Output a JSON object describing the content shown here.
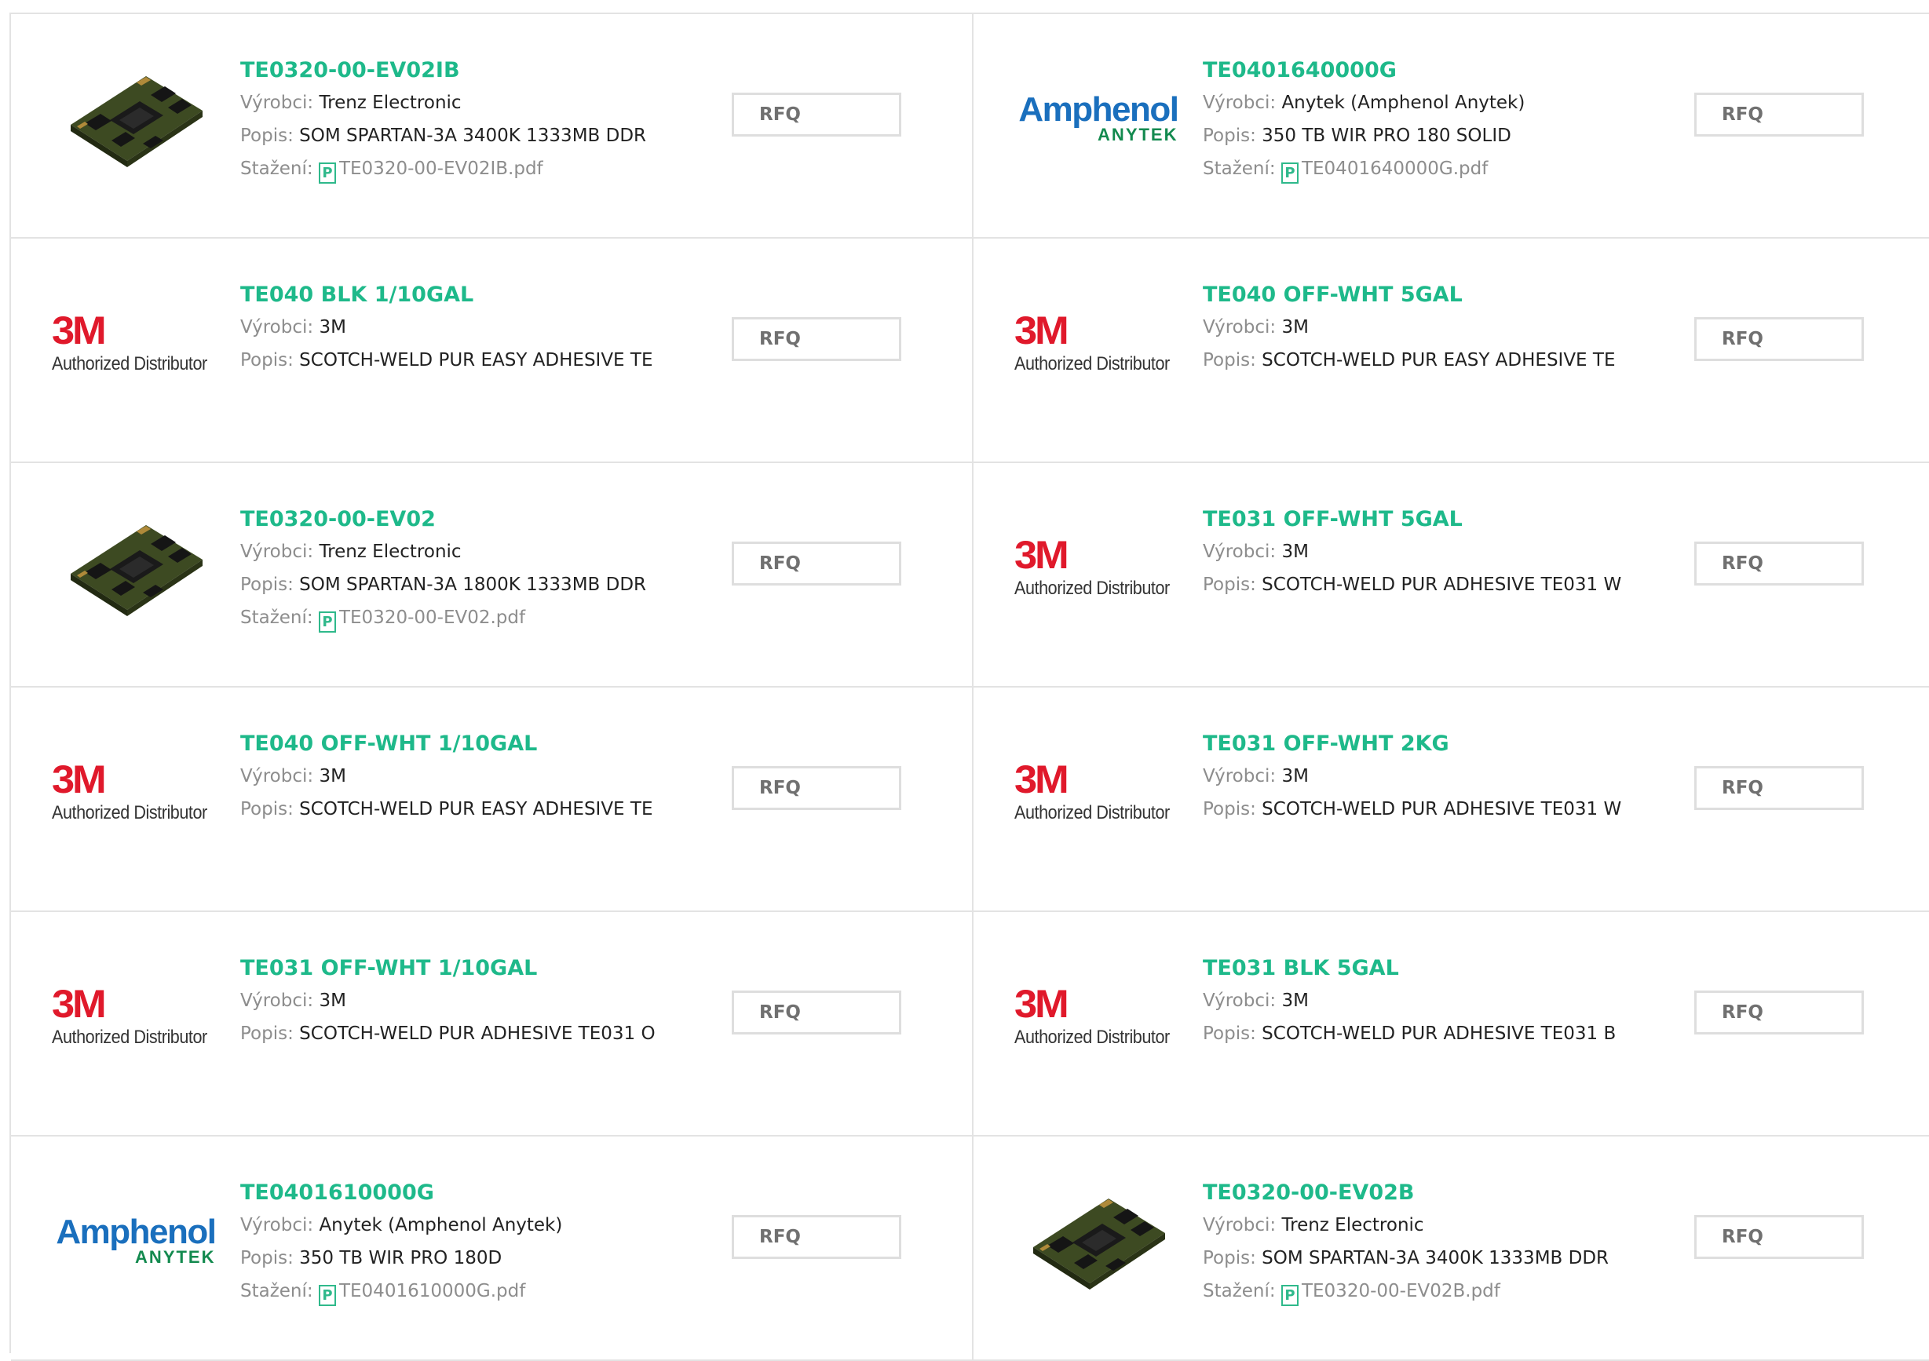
{
  "labels": {
    "manufacturer": "Výrobci:",
    "description": "Popis:",
    "download": "Stažení:",
    "rfq": "RFQ",
    "pdf_icon": "P"
  },
  "logos": {
    "3m": {
      "mark": "3M",
      "sub": "Authorized Distributor",
      "icon": "3m-logo",
      "color": "#e0192b"
    },
    "amphenol": {
      "mark": "Amphenol",
      "sub": "ANYTEK",
      "icon": "amphenol-anytek-logo",
      "color": "#1a6fbd"
    },
    "trenz": {
      "icon": "fpga-board-image"
    }
  },
  "colors": {
    "accent": "#1eb98a",
    "label": "#8d8d8d",
    "border": "#e3e3e3"
  },
  "products": [
    {
      "logo": "trenz",
      "title": "TE0320-00-EV02IB",
      "manufacturer": "Trenz Electronic",
      "description": "SOM SPARTAN-3A 3400K 1333MB DDR",
      "file": "TE0320-00-EV02IB.pdf"
    },
    {
      "logo": "amphenol",
      "title": "TE0401640000G",
      "manufacturer": "Anytek (Amphenol Anytek)",
      "description": "350 TB WIR PRO 180 SOLID",
      "file": "TE0401640000G.pdf"
    },
    {
      "logo": "3m",
      "title": "TE040 BLK 1/10GAL",
      "manufacturer": "3M",
      "description": "SCOTCH-WELD PUR EASY ADHESIVE TE"
    },
    {
      "logo": "3m",
      "title": "TE040 OFF-WHT 5GAL",
      "manufacturer": "3M",
      "description": "SCOTCH-WELD PUR EASY ADHESIVE TE"
    },
    {
      "logo": "trenz",
      "title": "TE0320-00-EV02",
      "manufacturer": "Trenz Electronic",
      "description": "SOM SPARTAN-3A 1800K 1333MB DDR",
      "file": "TE0320-00-EV02.pdf"
    },
    {
      "logo": "3m",
      "title": "TE031 OFF-WHT 5GAL",
      "manufacturer": "3M",
      "description": "SCOTCH-WELD PUR ADHESIVE TE031 W"
    },
    {
      "logo": "3m",
      "title": "TE040 OFF-WHT 1/10GAL",
      "manufacturer": "3M",
      "description": "SCOTCH-WELD PUR EASY ADHESIVE TE"
    },
    {
      "logo": "3m",
      "title": "TE031 OFF-WHT 2KG",
      "manufacturer": "3M",
      "description": "SCOTCH-WELD PUR ADHESIVE TE031 W"
    },
    {
      "logo": "3m",
      "title": "TE031 OFF-WHT 1/10GAL",
      "manufacturer": "3M",
      "description": "SCOTCH-WELD PUR ADHESIVE TE031 O"
    },
    {
      "logo": "3m",
      "title": "TE031 BLK 5GAL",
      "manufacturer": "3M",
      "description": "SCOTCH-WELD PUR ADHESIVE TE031 B"
    },
    {
      "logo": "amphenol",
      "title": "TE0401610000G",
      "manufacturer": "Anytek (Amphenol Anytek)",
      "description": "350 TB WIR PRO 180D",
      "file": "TE0401610000G.pdf"
    },
    {
      "logo": "trenz",
      "title": "TE0320-00-EV02B",
      "manufacturer": "Trenz Electronic",
      "description": "SOM SPARTAN-3A 3400K 1333MB DDR",
      "file": "TE0320-00-EV02B.pdf"
    }
  ]
}
